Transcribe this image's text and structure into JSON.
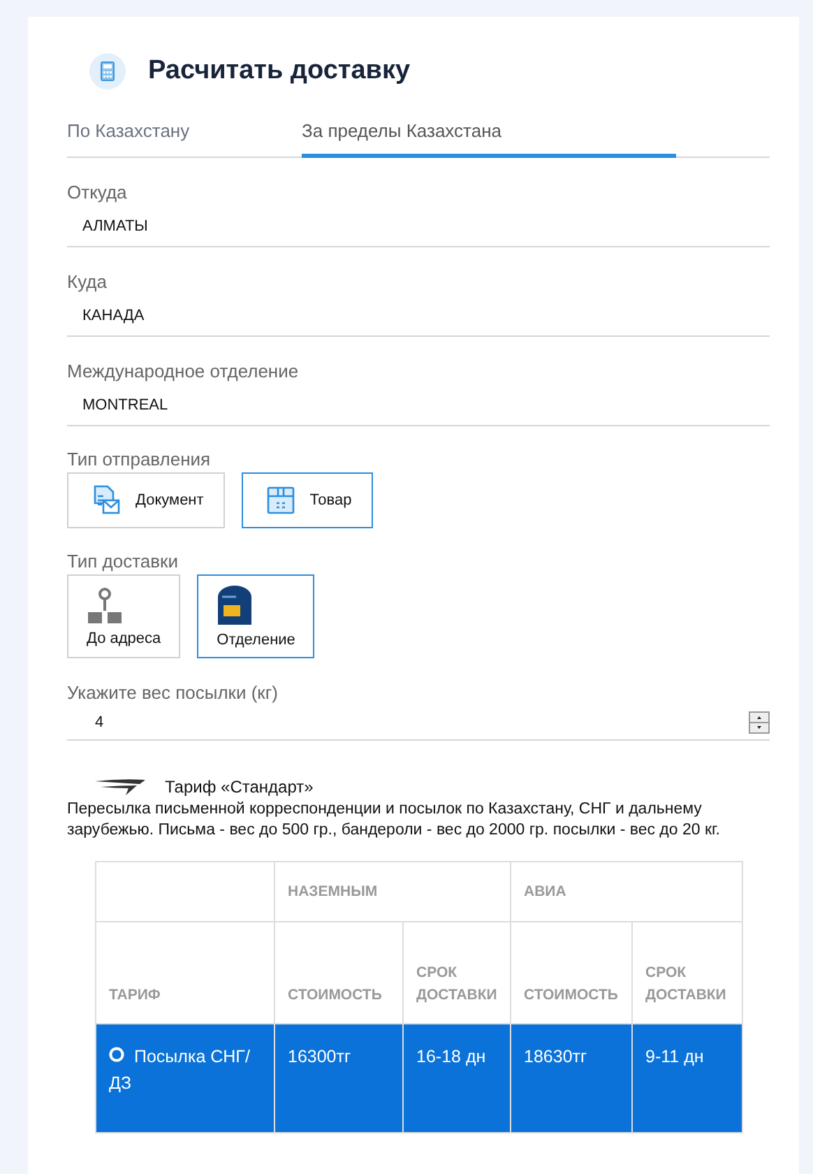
{
  "header": {
    "title": "Расчитать доставку"
  },
  "tabs": [
    {
      "label": "По Казахстану",
      "selected": false
    },
    {
      "label": "За пределы Казахстана",
      "selected": true
    }
  ],
  "fields": [
    {
      "label": "Откуда",
      "value": "АЛМАТЫ"
    },
    {
      "label": "Куда",
      "value": "КАНАДА"
    },
    {
      "label": "Международное отделение",
      "value": "MONTREAL"
    }
  ],
  "shipment_type": {
    "label": "Тип отправления",
    "options": [
      {
        "kind": "document",
        "label": "Документ",
        "selected": false
      },
      {
        "kind": "goods",
        "label": "Товар",
        "selected": true
      }
    ]
  },
  "delivery_type": {
    "label": "Тип доставки",
    "options": [
      {
        "kind": "address",
        "label": "До адреса",
        "selected": false
      },
      {
        "kind": "office",
        "label": "Отделение",
        "selected": true
      }
    ]
  },
  "weight": {
    "label": "Укажите вес посылки (кг)",
    "value": "4"
  },
  "tariff": {
    "title": "Тариф «Стандарт»",
    "description": "Пересылка письменной корреспонденции и посылок по Казахстану, СНГ и дальнему зарубежью. Письма - вес до 500 гр., бандероли - вес до 2000 гр. посылки - вес до 20 кг."
  },
  "table": {
    "groups": [
      "НАЗЕМНЫМ",
      "АВИА"
    ],
    "columns": [
      "ТАРИФ",
      "СТОИМОСТЬ",
      "СРОК ДОСТАВКИ",
      "СТОИМОСТЬ",
      "СРОК ДОСТАВКИ"
    ],
    "rows": [
      {
        "selected": true,
        "cells": [
          "Посылка СНГ/ДЗ",
          "16300тг",
          "16-18 дн",
          "18630тг",
          "9-11 дн"
        ]
      }
    ]
  }
}
